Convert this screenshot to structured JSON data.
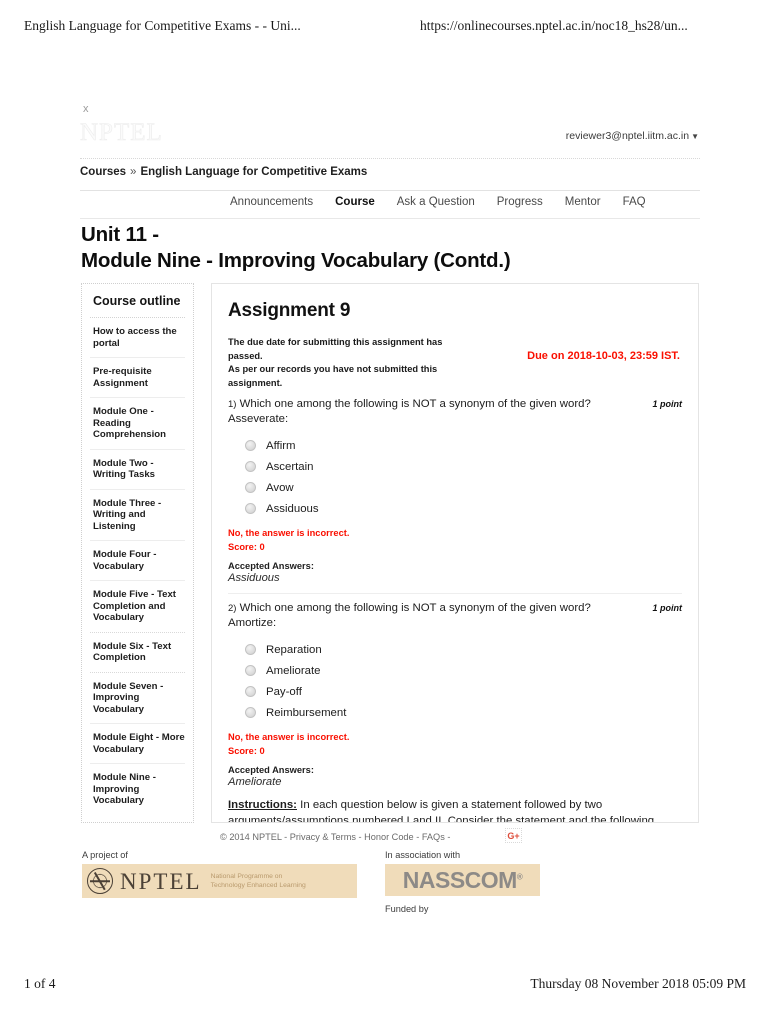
{
  "print": {
    "header_title": "English Language for Competitive Exams - - Uni...",
    "header_url": "https://onlinecourses.nptel.ac.in/noc18_hs28/un...",
    "footer_page": "1 of 4",
    "footer_date": "Thursday 08 November 2018 05:09 PM"
  },
  "header": {
    "close_label": "x",
    "brand": "NPTEL",
    "user_email": "reviewer3@nptel.iitm.ac.in",
    "user_caret": "▼",
    "breadcrumb_root": "Courses",
    "breadcrumb_sep": "»",
    "breadcrumb_current": "English Language for Competitive Exams"
  },
  "nav": {
    "tabs": [
      {
        "label": "Announcements",
        "active": false
      },
      {
        "label": "Course",
        "active": true
      },
      {
        "label": "Ask a Question",
        "active": false
      },
      {
        "label": "Progress",
        "active": false
      },
      {
        "label": "Mentor",
        "active": false
      },
      {
        "label": "FAQ",
        "active": false
      }
    ]
  },
  "page_title": {
    "line1": "Unit 11 -",
    "line2": "Module Nine - Improving Vocabulary (Contd.)"
  },
  "sidebar": {
    "heading": "Course outline",
    "items": [
      {
        "label": "How to access the portal"
      },
      {
        "label": "Pre-requisite Assignment"
      },
      {
        "label": "Module One - Reading Comprehension"
      },
      {
        "label": "Module Two - Writing Tasks"
      },
      {
        "label": "Module Three - Writing and Listening"
      },
      {
        "label": "Module Four - Vocabulary"
      },
      {
        "label": "Module Five - Text Completion and Vocabulary"
      },
      {
        "label": "Module Six - Text Completion"
      },
      {
        "label": "Module Seven - Improving Vocabulary"
      },
      {
        "label": "Module Eight - More Vocabulary"
      },
      {
        "label": "Module Nine - Improving Vocabulary"
      }
    ]
  },
  "assignment": {
    "title": "Assignment 9",
    "notice_line1": "The due date for submitting this assignment has passed.",
    "notice_line2": "As per our records you have not submitted this",
    "notice_line3": "assignment.",
    "due_text": "Due on 2018-10-03, 23:59 IST.",
    "due_color": "#fa0f00",
    "questions": [
      {
        "number": "1)",
        "prompt": "Which one among the following is NOT a synonym of the given word?",
        "points": "1 point",
        "word": "Asseverate:",
        "options": [
          "Affirm",
          "Ascertain",
          "Avow",
          "Assiduous"
        ],
        "feedback": "No, the answer is incorrect.",
        "score": "Score: 0",
        "accepted_label": "Accepted Answers:",
        "accepted_value": "Assiduous"
      },
      {
        "number": "2)",
        "prompt": "Which one among the following is NOT a synonym of the given word?",
        "points": "1 point",
        "word": "Amortize:",
        "options": [
          "Reparation",
          "Ameliorate",
          "Pay-off",
          "Reimbursement"
        ],
        "feedback": "No, the answer is incorrect.",
        "score": "Score: 0",
        "accepted_label": "Accepted Answers:",
        "accepted_value": "Ameliorate"
      }
    ],
    "instructions_label": "Instructions:",
    "instructions_text": " In each question below is given a statement followed by two arguments/assumptions numbered I and II. Consider the statement and the following arguments/assumptions and choose which of them is strong or"
  },
  "footer": {
    "links": "© 2014 NPTEL - Privacy & Terms - Honor Code - FAQs -",
    "gplus": "G+",
    "a_project_of": "A project of",
    "in_association_with": "In association with",
    "funded_by": "Funded by",
    "nptel_word": "NPTEL",
    "nptel_tagline_line1": "National Programme on",
    "nptel_tagline_line2": "Technology Enhanced Learning",
    "nasscom_word": "NASSCOM",
    "nasscom_reg": "®"
  }
}
